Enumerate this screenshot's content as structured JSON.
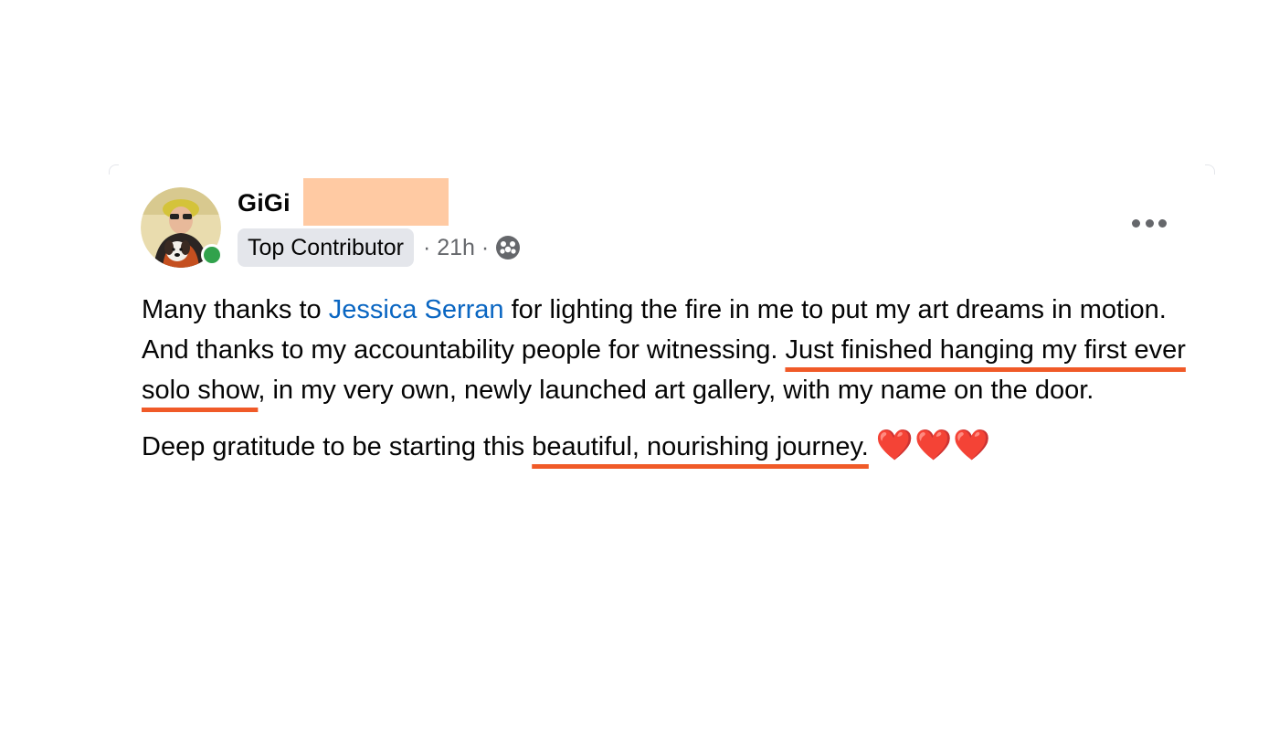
{
  "post": {
    "author": "GiGi",
    "badge": "Top Contributor",
    "time": "· 21h ·",
    "audience_icon": "globe-icon",
    "menu_icon": "more-options-icon",
    "online": true,
    "paragraph1": {
      "before_mention": "Many thanks to ",
      "mention": "Jessica Serran",
      "after_mention": " for lighting the fire in me to put my art dreams in motion. And thanks to my accountability people for witnessing. ",
      "highlight": "Just finished hanging my first ever solo show",
      "after_highlight": ", in my very own, newly launched art gallery, with my name on the door."
    },
    "paragraph2": {
      "before_highlight": "Deep gratitude to be starting this ",
      "highlight": "beautiful, nourishing journey.",
      "emoji": "❤️❤️❤️"
    }
  },
  "colors": {
    "mention": "#0a66c2",
    "underline_annotation": "#f05a28",
    "redaction": "#ffcaa3",
    "badge_bg": "#e4e6eb",
    "online_dot": "#31a24c"
  }
}
